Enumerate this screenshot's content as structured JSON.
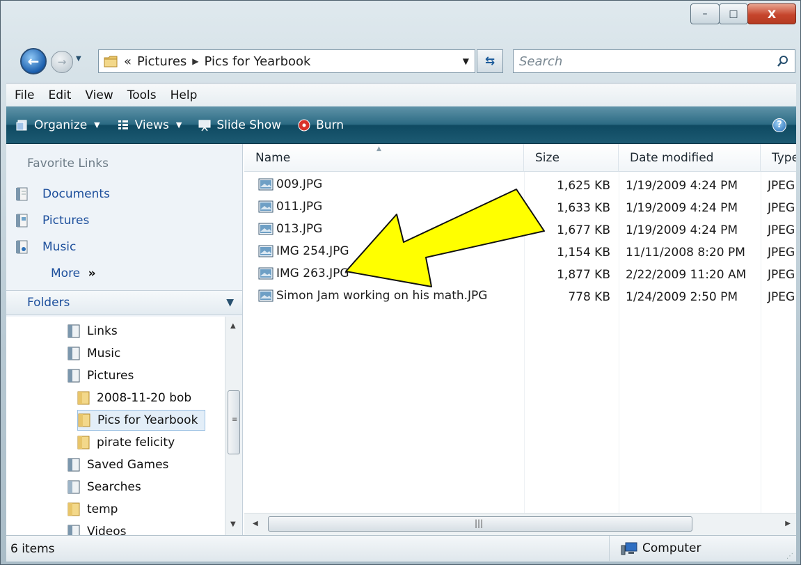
{
  "window": {
    "caption_buttons": {
      "minimize": "–",
      "maximize": "□",
      "close": "X"
    }
  },
  "nav": {
    "back_glyph": "←",
    "forward_glyph": "→",
    "breadcrumb_overflow": "«",
    "breadcrumb": [
      "Pictures",
      "Pics for Yearbook"
    ],
    "search_placeholder": "Search"
  },
  "menu": [
    "File",
    "Edit",
    "View",
    "Tools",
    "Help"
  ],
  "commands": {
    "organize": "Organize",
    "views": "Views",
    "slideshow": "Slide Show",
    "burn": "Burn",
    "help": "?"
  },
  "favorites": {
    "title": "Favorite Links",
    "items": [
      "Documents",
      "Pictures",
      "Music"
    ],
    "more": "More",
    "more_glyph": "»"
  },
  "folders": {
    "title": "Folders",
    "tree": [
      {
        "label": "Links",
        "icon": "links-folder-icon",
        "level": 1
      },
      {
        "label": "Music",
        "icon": "music-folder-icon",
        "level": 1
      },
      {
        "label": "Pictures",
        "icon": "pictures-folder-icon",
        "level": 1
      },
      {
        "label": "2008-11-20 bob",
        "icon": "folder-icon",
        "level": 2
      },
      {
        "label": "Pics for Yearbook",
        "icon": "folder-icon",
        "level": 2,
        "selected": true
      },
      {
        "label": "pirate felicity",
        "icon": "folder-icon",
        "level": 2
      },
      {
        "label": "Saved Games",
        "icon": "saved-games-icon",
        "level": 1
      },
      {
        "label": "Searches",
        "icon": "searches-icon",
        "level": 1
      },
      {
        "label": "temp",
        "icon": "folder-icon",
        "level": 1
      },
      {
        "label": "Videos",
        "icon": "videos-folder-icon",
        "level": 1
      }
    ]
  },
  "files": {
    "columns": [
      "Name",
      "Size",
      "Date modified",
      "Type"
    ],
    "rows": [
      {
        "name": "009.JPG",
        "size": "1,625 KB",
        "date": "1/19/2009 4:24 PM",
        "type": "JPEG"
      },
      {
        "name": "011.JPG",
        "size": "1,633 KB",
        "date": "1/19/2009 4:24 PM",
        "type": "JPEG"
      },
      {
        "name": "013.JPG",
        "size": "1,677 KB",
        "date": "1/19/2009 4:24 PM",
        "type": "JPEG"
      },
      {
        "name": "IMG 254.JPG",
        "size": "1,154 KB",
        "date": "11/11/2008 8:20 PM",
        "type": "JPEG"
      },
      {
        "name": "IMG 263.JPG",
        "size": "1,877 KB",
        "date": "2/22/2009 11:20 AM",
        "type": "JPEG"
      },
      {
        "name": "Simon Jam working on his math.JPG",
        "size": "778 KB",
        "date": "1/24/2009 2:50 PM",
        "type": "JPEG"
      }
    ]
  },
  "status": {
    "item_count": "6 items",
    "zone": "Computer"
  },
  "colors": {
    "annotation_arrow": "#ffff00",
    "command_bar": "#1c5a72",
    "link_text": "#1d4f9c"
  }
}
